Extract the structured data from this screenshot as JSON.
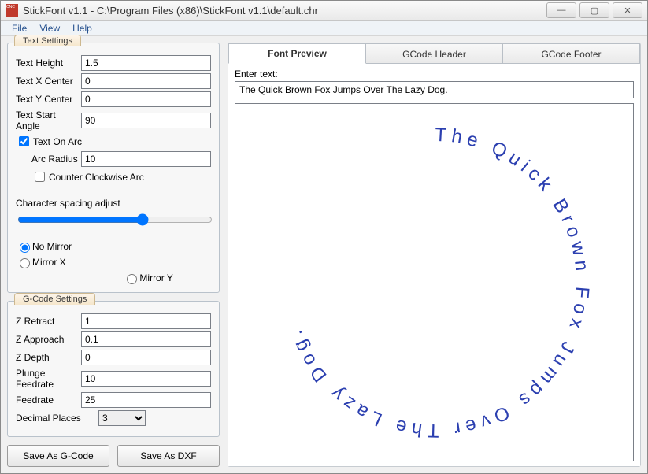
{
  "window": {
    "title": "StickFont v1.1 - C:\\Program Files (x86)\\StickFont v1.1\\default.chr"
  },
  "menu": {
    "file": "File",
    "view": "View",
    "help": "Help"
  },
  "textSettings": {
    "title": "Text Settings",
    "textHeight_label": "Text Height",
    "textHeight": "1.5",
    "textXCenter_label": "Text X Center",
    "textXCenter": "0",
    "textYCenter_label": "Text Y Center",
    "textYCenter": "0",
    "textStartAngle_label": "Text Start Angle",
    "textStartAngle": "90",
    "textOnArc_label": "Text On Arc",
    "arcRadius_label": "Arc Radius",
    "arcRadius": "10",
    "ccwArc_label": "Counter Clockwise Arc",
    "charSpacing_label": "Character spacing adjust",
    "noMirror_label": "No Mirror",
    "mirrorX_label": "Mirror X",
    "mirrorY_label": "Mirror Y"
  },
  "gcodeSettings": {
    "title": "G-Code Settings",
    "zRetract_label": "Z Retract",
    "zRetract": "1",
    "zApproach_label": "Z Approach",
    "zApproach": "0.1",
    "zDepth_label": "Z Depth",
    "zDepth": "0",
    "plungeFeed_label": "Plunge Feedrate",
    "plungeFeed": "10",
    "feedrate_label": "Feedrate",
    "feedrate": "25",
    "decPlaces_label": "Decimal Places",
    "decPlaces": "3"
  },
  "buttons": {
    "saveGcode": "Save As G-Code",
    "saveDxf": "Save As DXF"
  },
  "tabs": {
    "preview": "Font Preview",
    "header": "GCode Header",
    "footer": "GCode Footer"
  },
  "preview": {
    "enterText_label": "Enter text:",
    "enterText": "The Quick Brown Fox Jumps Over The Lazy Dog.",
    "circleText": "The Quick Brown Fox Jumps Over The Lazy Dog. "
  },
  "colors": {
    "arcText": "#2b3fb0"
  }
}
